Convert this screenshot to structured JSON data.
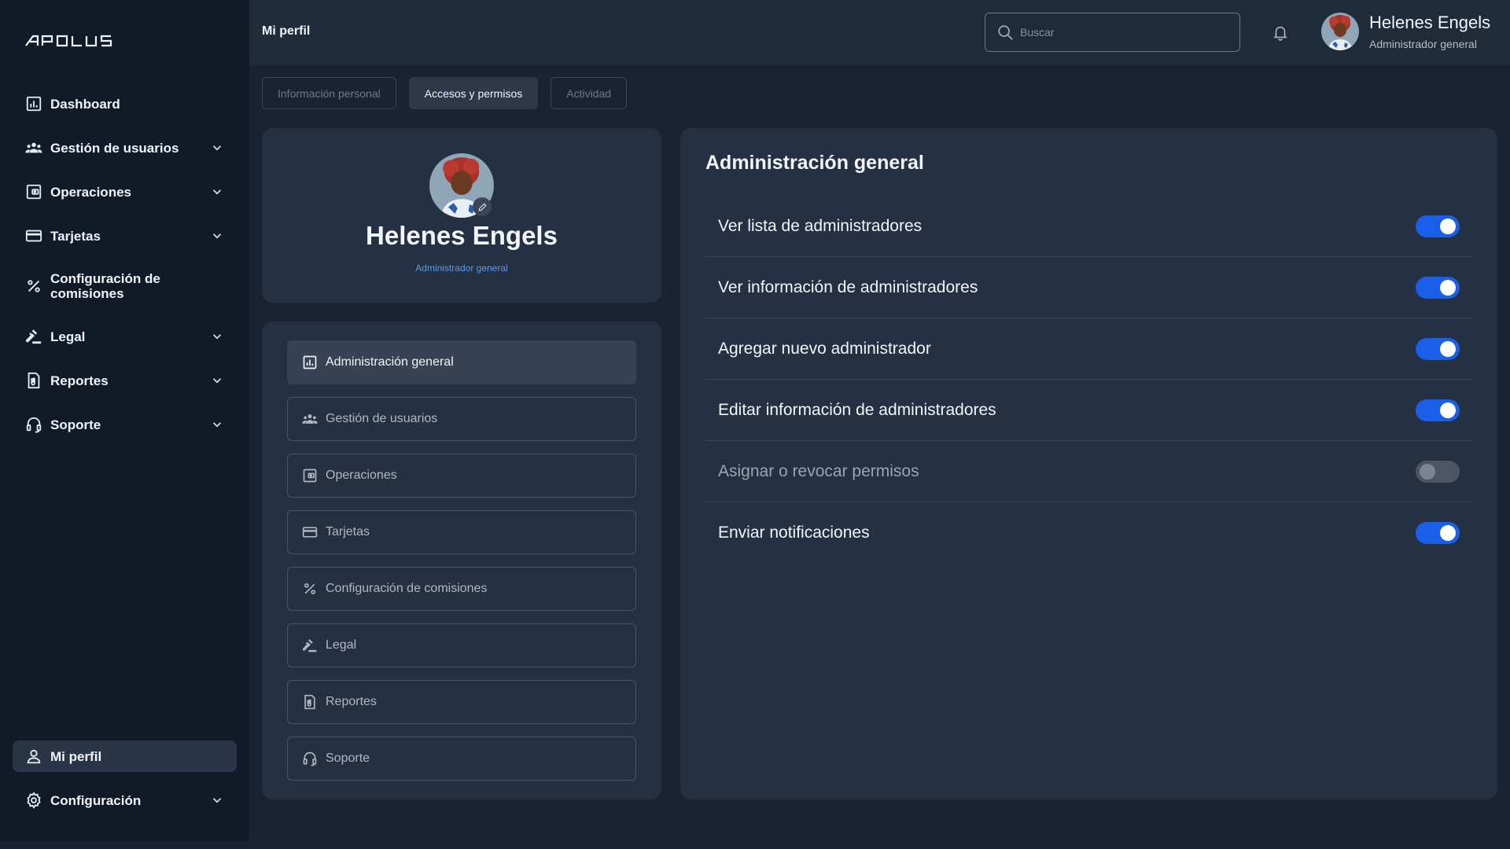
{
  "app": {
    "logo_text": "APOLUS"
  },
  "sidebar": {
    "items": [
      {
        "label": "Dashboard",
        "icon": "dashboard-icon",
        "has_chevron": false
      },
      {
        "label": "Gestión de usuarios",
        "icon": "users-icon",
        "has_chevron": true
      },
      {
        "label": "Operaciones",
        "icon": "wallet-icon",
        "has_chevron": true
      },
      {
        "label": "Tarjetas",
        "icon": "card-icon",
        "has_chevron": true
      },
      {
        "label": "Configuración de comisiones",
        "icon": "percent-icon",
        "has_chevron": false
      },
      {
        "label": "Legal",
        "icon": "gavel-icon",
        "has_chevron": true
      },
      {
        "label": "Reportes",
        "icon": "report-icon",
        "has_chevron": true
      },
      {
        "label": "Soporte",
        "icon": "headset-icon",
        "has_chevron": true
      }
    ],
    "bottom": [
      {
        "label": "Mi perfil",
        "icon": "user-icon",
        "active": true
      },
      {
        "label": "Configuración",
        "icon": "gear-icon",
        "has_chevron": true
      }
    ]
  },
  "header": {
    "title": "Mi perfil",
    "search_placeholder": "Buscar",
    "user_name": "Helenes Engels",
    "user_role": "Administrador general"
  },
  "tabs": [
    {
      "label": "Información personal",
      "active": false
    },
    {
      "label": "Accesos y permisos",
      "active": true
    },
    {
      "label": "Actividad",
      "active": false
    }
  ],
  "profile": {
    "name": "Helenes Engels",
    "role": "Administrador general"
  },
  "permission_sections": [
    {
      "label": "Administración general",
      "icon": "dashboard-icon",
      "active": true
    },
    {
      "label": "Gestión de usuarios",
      "icon": "users-icon"
    },
    {
      "label": "Operaciones",
      "icon": "wallet-icon"
    },
    {
      "label": "Tarjetas",
      "icon": "card-icon"
    },
    {
      "label": "Configuración de comisiones",
      "icon": "percent-icon"
    },
    {
      "label": "Legal",
      "icon": "gavel-icon"
    },
    {
      "label": "Reportes",
      "icon": "report-icon"
    },
    {
      "label": "Soporte",
      "icon": "headset-icon"
    }
  ],
  "permissions_panel": {
    "title": "Administración general",
    "items": [
      {
        "label": "Ver lista de administradores",
        "enabled": true
      },
      {
        "label": "Ver información de administradores",
        "enabled": true
      },
      {
        "label": "Agregar nuevo administrador",
        "enabled": true
      },
      {
        "label": "Editar información de administradores",
        "enabled": true
      },
      {
        "label": "Asignar o revocar permisos",
        "enabled": false
      },
      {
        "label": "Enviar notificaciones",
        "enabled": true
      }
    ]
  },
  "colors": {
    "background": "#1a2332",
    "sidebar": "#111a27",
    "card": "#253142",
    "accent": "#1b5ee8",
    "role_link": "#5a9bf0"
  }
}
